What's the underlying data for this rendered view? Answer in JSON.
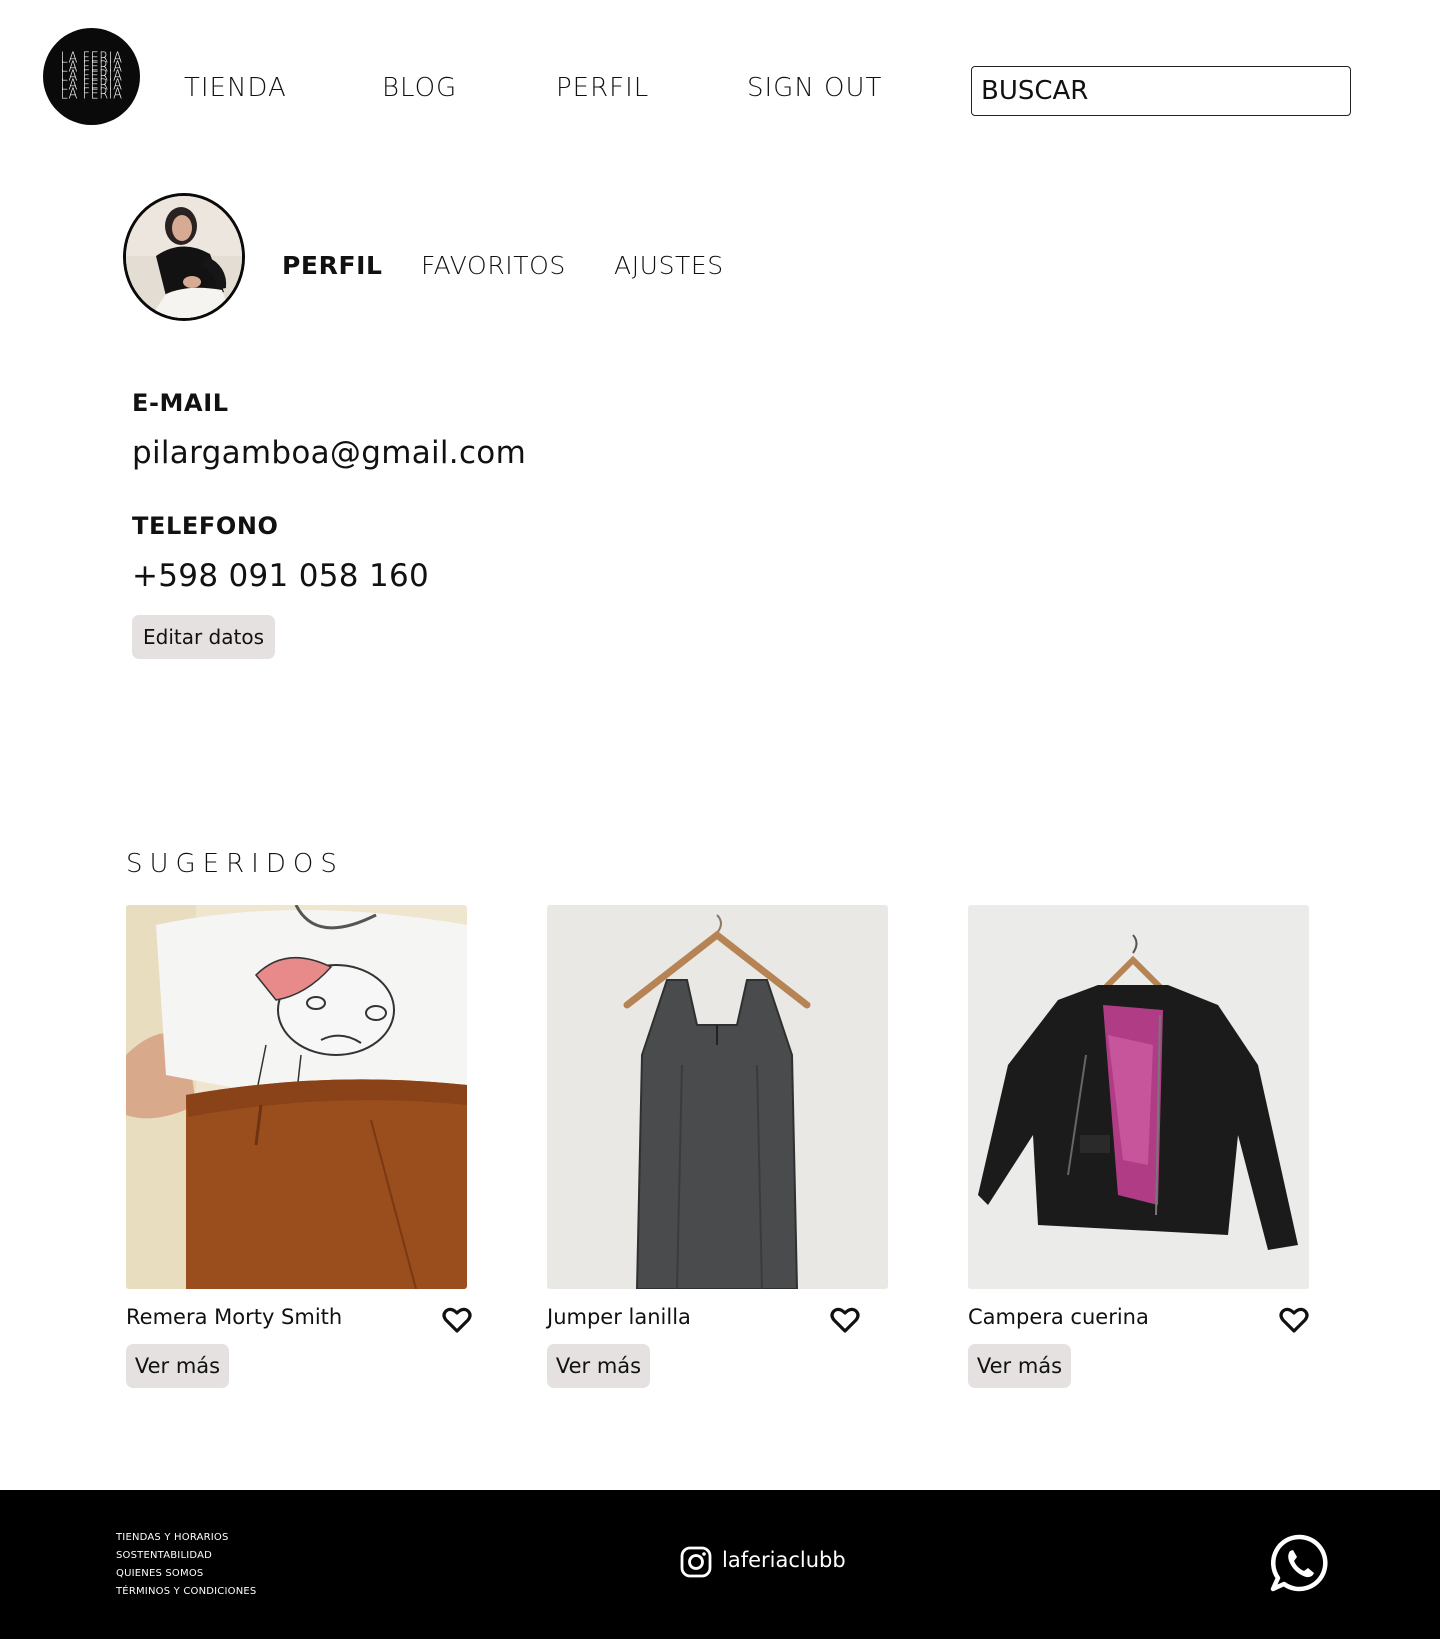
{
  "header": {
    "logo_lines": [
      "LA FERIA",
      "LA FERIA",
      "LA FERIA",
      "LA FERIA",
      "LA FERIA"
    ],
    "nav": [
      {
        "label": "TIENDA"
      },
      {
        "label": "BLOG"
      },
      {
        "label": "PERFIL"
      },
      {
        "label": "SIGN OUT"
      }
    ],
    "search_placeholder": "BUSCAR"
  },
  "profile": {
    "tabs": [
      {
        "label": "PERFIL",
        "active": true
      },
      {
        "label": "FAVORITOS",
        "active": false
      },
      {
        "label": "AJUSTES",
        "active": false
      }
    ],
    "email_label": "E-MAIL",
    "email_value": "pilargamboa@gmail.com",
    "phone_label": "TELEFONO",
    "phone_value": "+598 091 058 160",
    "edit_label": "Editar datos"
  },
  "suggested": {
    "title": "SUGERIDOS",
    "items": [
      {
        "name": "Remera Morty Smith",
        "button": "Ver más",
        "icon": "heart-outline-icon"
      },
      {
        "name": "Jumper lanilla",
        "button": "Ver más",
        "icon": "heart-outline-icon"
      },
      {
        "name": "Campera cuerina",
        "button": "Ver más",
        "icon": "heart-outline-icon"
      }
    ]
  },
  "footer": {
    "links": [
      "TIENDAS Y HORARIOS",
      "SOSTENTABILIDAD",
      "QUIENES SOMOS",
      "TÉRMINOS Y CONDICIONES"
    ],
    "instagram_handle": "laferiaclubb",
    "icons": [
      "instagram-icon",
      "whatsapp-icon"
    ]
  },
  "colors": {
    "button_bg": "#e6e1e1",
    "footer_bg": "#000000",
    "text": "#111111"
  }
}
